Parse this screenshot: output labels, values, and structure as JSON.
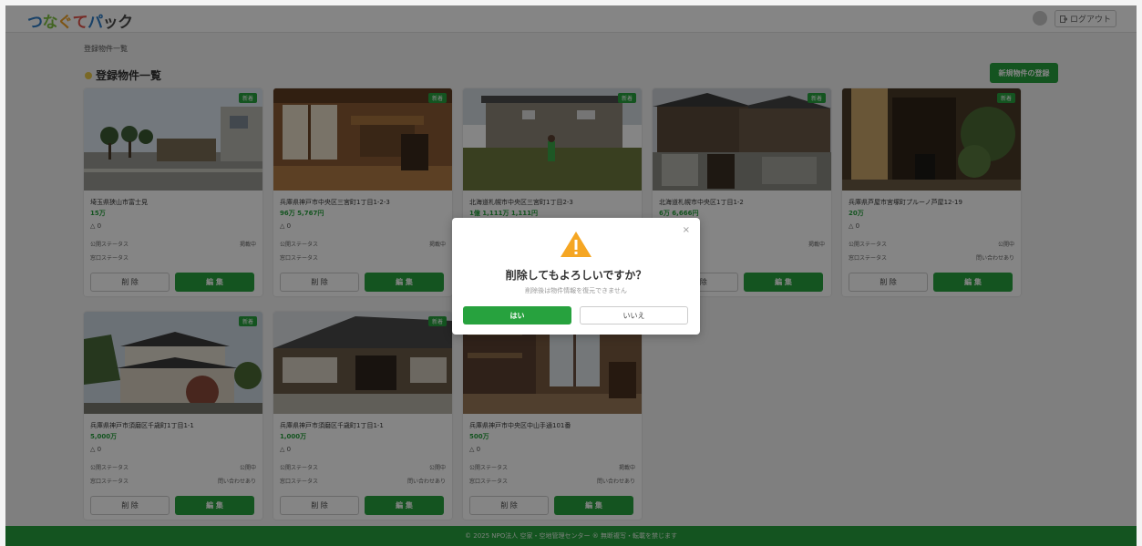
{
  "app": {
    "logo_chars": [
      "つ",
      "な",
      "ぐ",
      "て",
      "パ",
      "ッ",
      "ク"
    ],
    "logout_label": "ログアウト",
    "brand_color": "#27a23e"
  },
  "breadcrumb": "登録物件一覧",
  "page_title": "登録物件一覧",
  "register_button": "新規物件の登録",
  "card_labels": {
    "new_badge": "新着",
    "public_status": "公開ステータス",
    "contact_status": "窓口ステータス",
    "delete": "削 除",
    "edit": "編 集"
  },
  "cards": [
    {
      "address": "埼玉県狭山市富士見",
      "price": "15万",
      "likes": "0",
      "public_value": "掲載中",
      "contact_value": "",
      "image": "station-street"
    },
    {
      "address": "兵庫県神戸市中央区三宮町1丁目1-2-3",
      "price": "96万 5,767円",
      "likes": "0",
      "public_value": "掲載中",
      "contact_value": "",
      "image": "wooden-interior"
    },
    {
      "address": "北海道札幌市中央区三宮町1丁目2-3",
      "price": "1億 1,111万 1,111円",
      "likes": "",
      "public_value": "",
      "contact_value": "",
      "image": "old-house-field"
    },
    {
      "address": "北海道札幌市中央区1丁目1-2",
      "price": "6万 6,666円",
      "likes": "",
      "public_value": "掲載中",
      "contact_value": "",
      "image": "tiled-houses"
    },
    {
      "address": "兵庫県芦屋市宮塚町プルーノ芦屋12-19",
      "price": "20万",
      "likes": "0",
      "public_value": "公開中",
      "contact_value": "問い合わせあり",
      "image": "shop-front"
    },
    {
      "address": "兵庫県神戸市須磨区千歳町1丁目1-1",
      "price": "5,000万",
      "likes": "0",
      "public_value": "公開中",
      "contact_value": "問い合わせあり",
      "image": "japanese-house"
    },
    {
      "address": "兵庫県神戸市須磨区千歳町1丁目1-1",
      "price": "1,000万",
      "likes": "0",
      "public_value": "公開中",
      "contact_value": "問い合わせあり",
      "image": "long-house"
    },
    {
      "address": "兵庫県神戸市中央区中山手通101番",
      "price": "500万",
      "likes": "0",
      "public_value": "掲載中",
      "contact_value": "問い合わせあり",
      "image": "cafe-interior"
    }
  ],
  "footer": "© 2025 NPO法人 空家・空地管理センター ® 無断複写・転載を禁じます",
  "modal": {
    "title": "削除してもよろしいですか？",
    "subtitle": "削除後は物件情報を復元できません",
    "yes": "はい",
    "no": "いいえ",
    "close": "×",
    "icon": "warning-icon",
    "icon_color": "#f5a623"
  }
}
